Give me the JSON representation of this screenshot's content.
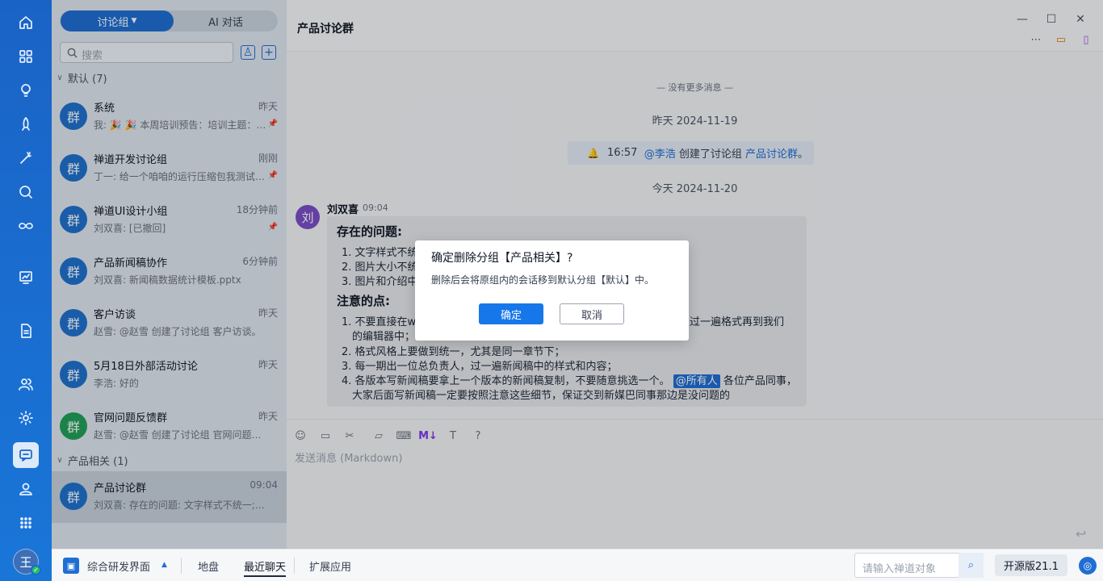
{
  "rail": {
    "icons": [
      "home-icon",
      "apps-grid-icon",
      "bulb-icon",
      "rocket-icon",
      "wand-icon",
      "search-icon",
      "infinity-icon",
      "screen-icon",
      "document-icon",
      "users-icon",
      "gear-icon",
      "chat-icon",
      "person-icon",
      "more-apps-icon"
    ],
    "avatar": "王"
  },
  "sidebar": {
    "tabs": {
      "discussion": "讨论组",
      "ai": "AI 对话"
    },
    "search_placeholder": "搜索",
    "groups": [
      {
        "label": "默认 (7)"
      },
      {
        "label": "产品相关 (1)"
      }
    ],
    "items": [
      {
        "avatar": "群",
        "name": "系统",
        "time": "昨天",
        "preview": "我: 🎉 🎉 本周培训预告：培训主题：…",
        "pinned": true
      },
      {
        "avatar": "群",
        "name": "禅道开发讨论组",
        "time": "刚刚",
        "preview": "丁一: 给一个咱咱的运行压缩包我测试…",
        "pinned": true
      },
      {
        "avatar": "群",
        "name": "禅道UI设计小组",
        "time": "18分钟前",
        "preview": "刘双喜: [已撤回]",
        "pinned": true
      },
      {
        "avatar": "群",
        "name": "产品新闻稿协作",
        "time": "6分钟前",
        "preview": "刘双喜: 新闻稿数据统计模板.pptx",
        "pinned": false
      },
      {
        "avatar": "群",
        "name": "客户访谈",
        "time": "昨天",
        "preview": "赵雪: @赵雪 创建了讨论组 客户访谈。",
        "pinned": false
      },
      {
        "avatar": "群",
        "name": "5月18日外部活动讨论",
        "time": "昨天",
        "preview": "李浩: 好的",
        "pinned": false
      },
      {
        "avatar": "群",
        "name": "官网问题反馈群",
        "time": "昨天",
        "preview": "赵雪: @赵雪 创建了讨论组 官网问题反…",
        "pinned": false
      },
      {
        "avatar": "群",
        "name": "产品讨论群",
        "time": "09:04",
        "preview": "刘双喜: 存在的问题:  文字样式不统一; …",
        "pinned": false
      }
    ]
  },
  "chat": {
    "title": "产品讨论群",
    "no_more": "— 没有更多消息 —",
    "date1": "昨天 2024-11-19",
    "system": {
      "time": "16:57",
      "user": "@李浩",
      "action": "创建了讨论组",
      "group": "产品讨论群",
      "end": "。"
    },
    "date2": "今天 2024-11-20",
    "message": {
      "avatar": "刘",
      "sender": "刘双喜",
      "time": "09:04",
      "h1": "存在的问题:",
      "p1": [
        "1. 文字样式不统",
        "2. 图片大小不统",
        "3. 图片和介绍中"
      ],
      "h2": "注意的点:",
      "n1a": "1. 不要直接在wo",
      "n1b": "里过一遍格式再到我们",
      "n1c": "的编辑器中；",
      "n2": "2. 格式风格上要做到统一，尤其是同一章节下；",
      "n3": "3. 每一期出一位总负责人，过一遍新闻稿中的样式和内容；",
      "n4a": "4. 各版本写新闻稿要拿上一个版本的新闻稿复制，不要随意挑选一个。",
      "mention": "@所有人",
      "n4b": "各位产品同事，",
      "n4c": "大家后面写新闻稿一定要按照注意这些细节，保证交到新媒巴同事那边是没问题的"
    },
    "compose_placeholder": "发送消息 (Markdown)"
  },
  "modal": {
    "title": "确定删除分组【产品相关】?",
    "body": "删除后会将原组内的会话移到默认分组【默认】中。",
    "ok": "确定",
    "cancel": "取消"
  },
  "bottom": {
    "workspace": "综合研发界面",
    "tabs": [
      "地盘",
      "最近聊天",
      "扩展应用"
    ],
    "search_placeholder": "请输入禅道对象",
    "version": "开源版21.1"
  }
}
